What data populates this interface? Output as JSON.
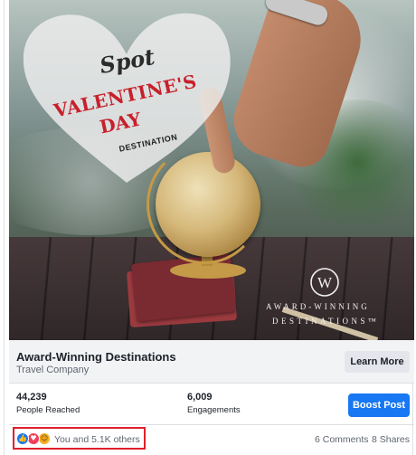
{
  "ad_image": {
    "heart_text": {
      "spot": "Spot",
      "valentines": "VALENTINE'S",
      "day": "DAY",
      "destination": "DESTINATION"
    },
    "logo": {
      "mark": "W",
      "line1": "AWARD-WINNING",
      "line2": "DESTINATIONS™"
    }
  },
  "link": {
    "title": "Award-Winning Destinations",
    "subtitle": "Travel Company",
    "cta_label": "Learn More"
  },
  "stats": {
    "people_reached_value": "44,239",
    "people_reached_label": "People Reached",
    "engagements_value": "6,009",
    "engagements_label": "Engagements",
    "boost_label": "Boost Post"
  },
  "reactions": {
    "icons": [
      "like-icon",
      "love-icon",
      "haha-icon"
    ],
    "summary": "You and 5.1K others",
    "comments": "6 Comments",
    "shares": "8 Shares"
  },
  "colors": {
    "brand_blue": "#1877f2",
    "highlight_red": "#e0202b",
    "headline_red": "#c8202b"
  }
}
